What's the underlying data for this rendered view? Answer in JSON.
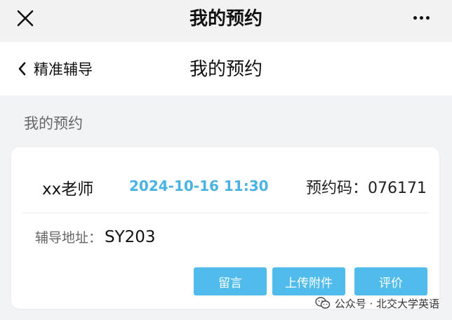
{
  "topbar": {
    "title": "我的预约",
    "close_icon": "close-icon",
    "more_icon": "more-horizontal-icon"
  },
  "navbar": {
    "back_label": "精准辅导",
    "title": "我的预约",
    "back_icon": "chevron-left-icon"
  },
  "section": {
    "title": "我的预约"
  },
  "appointment": {
    "teacher": "xx老师",
    "datetime": "2024-10-16 11:30",
    "code_text": "预约码：076171",
    "address_label": "辅导地址：",
    "address_value": "SY203",
    "buttons": {
      "message": "留言",
      "upload": "上传附件",
      "evaluate": "评价"
    }
  },
  "watermark": {
    "text": "公众号 · 北交大学英语",
    "icon": "wechat-icon"
  },
  "colors": {
    "accent": "#49b3e4",
    "button": "#50bcec",
    "background": "#f2f3f5"
  }
}
